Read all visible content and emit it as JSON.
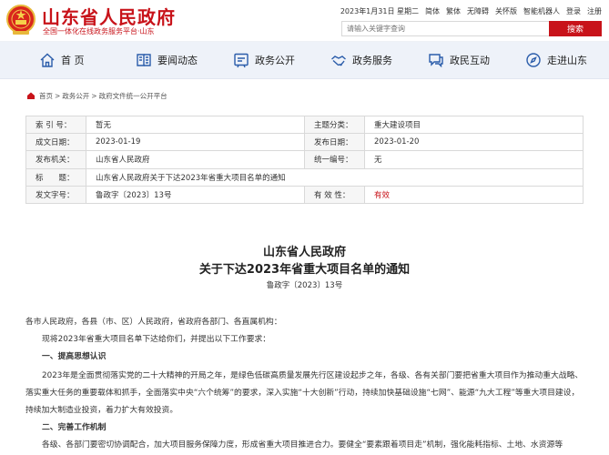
{
  "site": {
    "name": "山东省人民政府",
    "slogan": "全国一体化在线政务服务平台·山东"
  },
  "topbar": {
    "date": "2023年1月31日 星期二",
    "links": [
      "简体",
      "繁体",
      "无障碍",
      "关怀版",
      "智能机器人",
      "登录",
      "注册"
    ]
  },
  "search": {
    "placeholder": "请输入关键字查询",
    "button": "搜索"
  },
  "nav": [
    {
      "label": "首 页",
      "icon": "home-icon"
    },
    {
      "label": "要闻动态",
      "icon": "newspaper-icon"
    },
    {
      "label": "政务公开",
      "icon": "megaphone-icon"
    },
    {
      "label": "政务服务",
      "icon": "handshake-icon"
    },
    {
      "label": "政民互动",
      "icon": "chat-icon"
    },
    {
      "label": "走进山东",
      "icon": "location-pin-icon"
    }
  ],
  "breadcrumb": [
    "首页",
    "政务公开",
    "政府文件统一公开平台"
  ],
  "info": {
    "index_label": "索 引 号：",
    "index_value": "暂无",
    "category_label": "主题分类：",
    "category_value": "重大建设项目",
    "created_label": "成文日期：",
    "created_value": "2023-01-19",
    "published_label": "发布日期：",
    "published_value": "2023-01-20",
    "issuer_label": "发布机关：",
    "issuer_value": "山东省人民政府",
    "serial_label": "统一编号：",
    "serial_value": "无",
    "title_label": "标　　题：",
    "title_value": "山东省人民政府关于下达2023年省重大项目名单的通知",
    "docno_label": "发文字号：",
    "docno_value": "鲁政字〔2023〕13号",
    "validity_label": "有 效 性：",
    "validity_value": "有效"
  },
  "article": {
    "title_line1": "山东省人民政府",
    "title_line2": "关于下达2023年省重大项目名单的通知",
    "doc_number": "鲁政字〔2023〕13号",
    "salutation": "各市人民政府，各县（市、区）人民政府，省政府各部门、各直属机构：",
    "intro": "现将2023年省重大项目名单下达给你们，并提出以下工作要求：",
    "heading1": "一、提高思想认识",
    "para1": "2023年是全面贯彻落实党的二十大精神的开局之年，是绿色低碳高质量发展先行区建设起步之年，各级、各有关部门要把省重大项目作为推动重大战略、落实重大任务的重要载体和抓手，全面落实中央“六个统筹”的要求，深入实施“十大创新”行动，持续加快基础设施“七网”、能源“九大工程”等重大项目建设，持续加大制造业投资，着力扩大有效投资。",
    "heading2": "二、完善工作机制",
    "para2": "各级、各部门要密切协调配合，加大项目服务保障力度，形成省重大项目推进合力。要健全“要素跟着项目走”机制，强化能耗指标、土地、水资源等"
  }
}
